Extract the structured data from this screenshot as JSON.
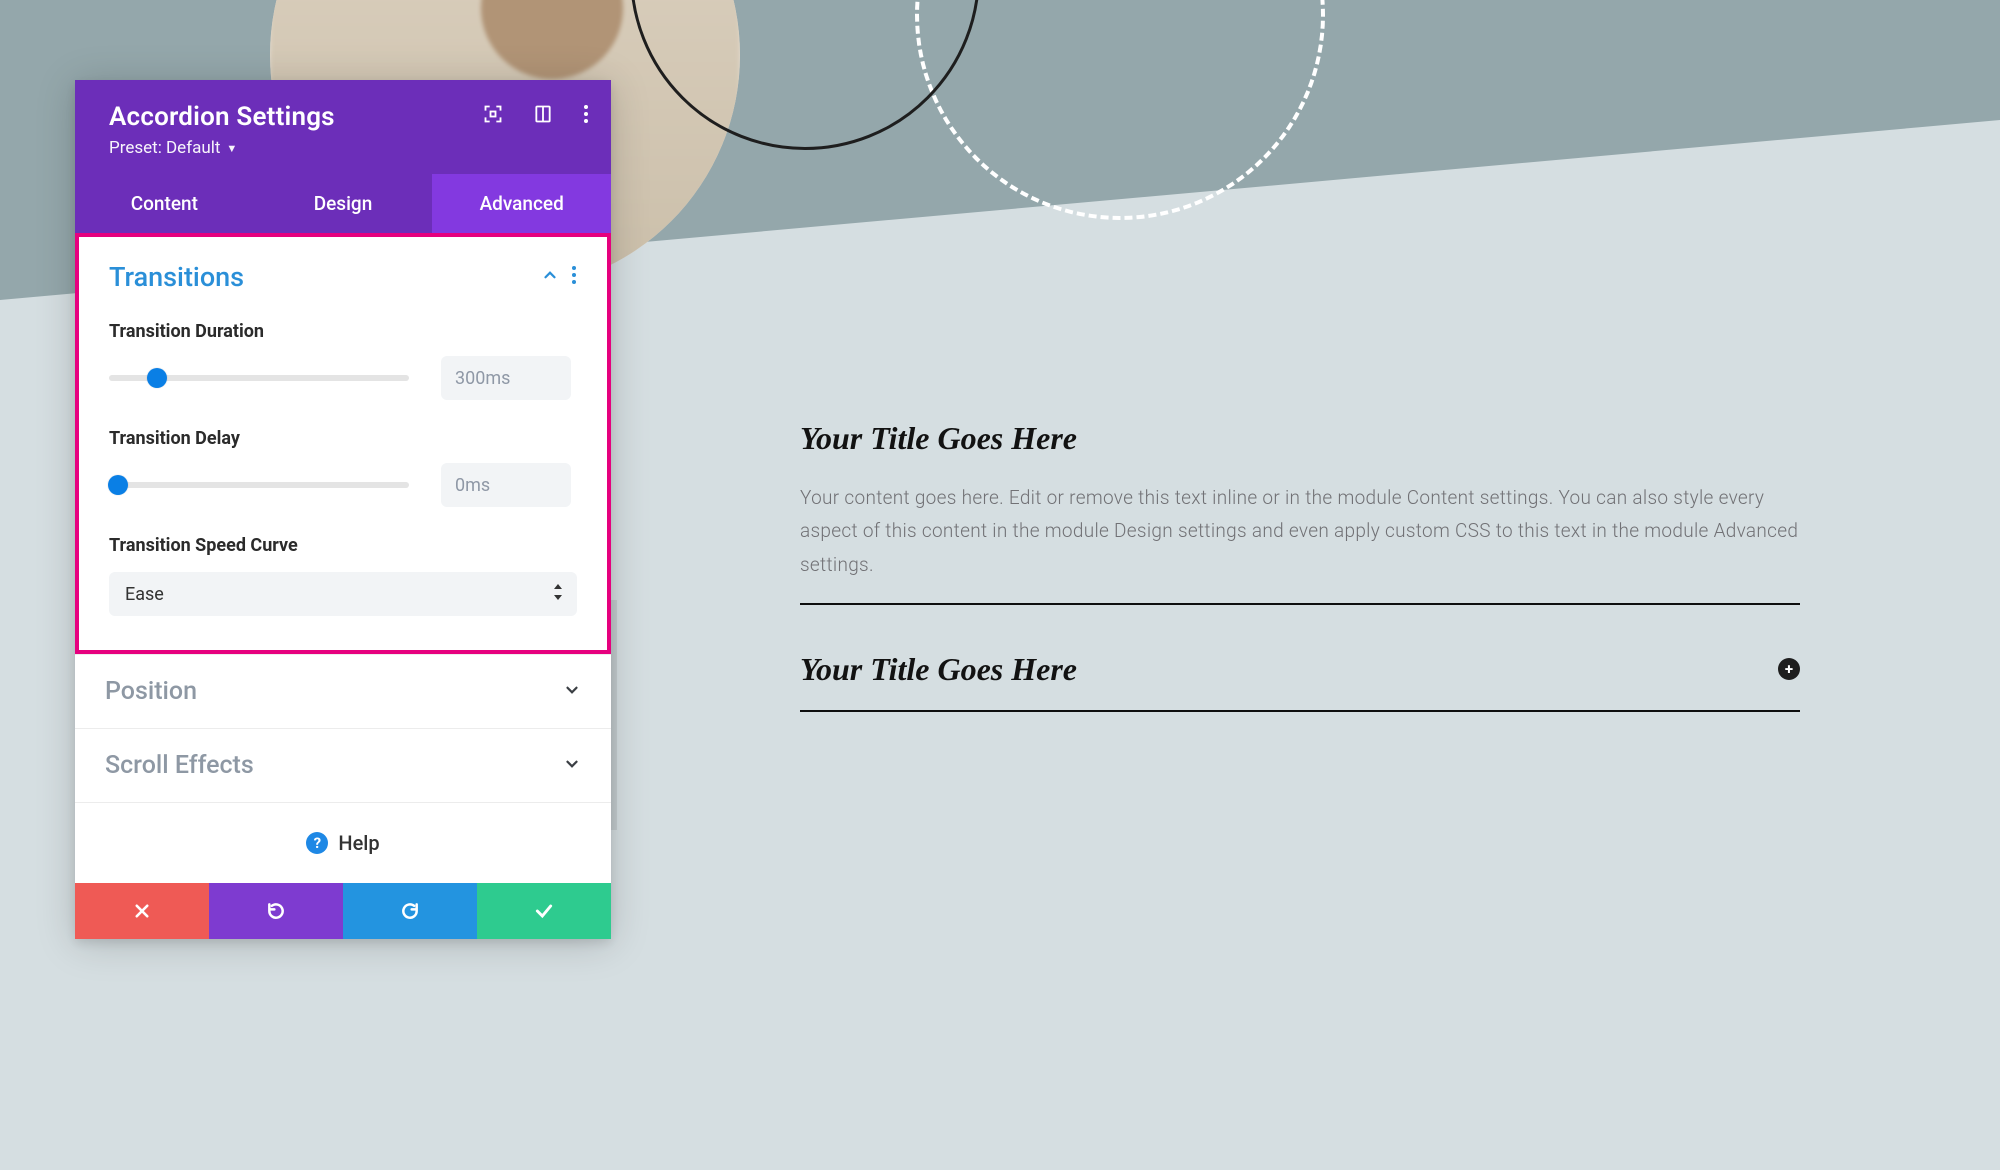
{
  "panel": {
    "title": "Accordion Settings",
    "preset_label": "Preset: Default",
    "tabs": {
      "content": "Content",
      "design": "Design",
      "advanced": "Advanced"
    }
  },
  "transitions": {
    "heading": "Transitions",
    "duration_label": "Transition Duration",
    "duration_value": "300ms",
    "duration_pct": 16,
    "delay_label": "Transition Delay",
    "delay_value": "0ms",
    "delay_pct": 3,
    "curve_label": "Transition Speed Curve",
    "curve_value": "Ease"
  },
  "collapsed_sections": {
    "position": "Position",
    "scroll_effects": "Scroll Effects"
  },
  "help_label": "Help",
  "accordion": {
    "items": [
      {
        "title": "Your Title Goes Here",
        "body": "Your content goes here. Edit or remove this text inline or in the module Content settings. You can also style every aspect of this content in the module Design settings and even apply custom CSS to this text in the module Advanced settings.",
        "open": true
      },
      {
        "title": "Your Title Goes Here",
        "body": "",
        "open": false
      }
    ]
  }
}
